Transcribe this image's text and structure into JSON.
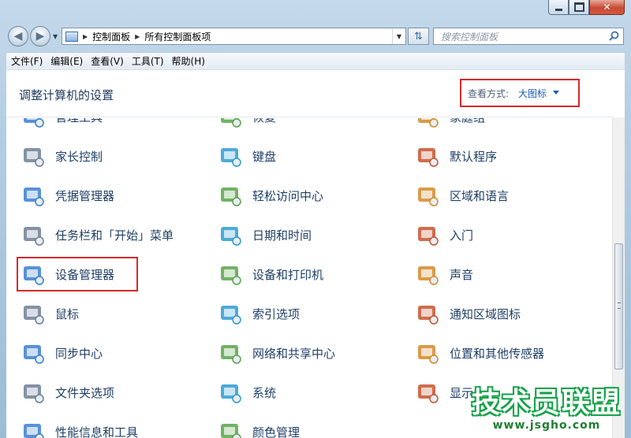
{
  "window": {
    "address_crumbs": [
      "控制面板",
      "所有控制面板项"
    ],
    "search_placeholder": "搜索控制面板"
  },
  "menu": [
    "文件(F)",
    "编辑(E)",
    "查看(V)",
    "工具(T)",
    "帮助(H)"
  ],
  "header": {
    "title": "调整计算机的设置",
    "view_label": "查看方式:",
    "view_value": "大图标"
  },
  "items": [
    {
      "label": "管理工具",
      "icon": "admin-tools-icon"
    },
    {
      "label": "恢复",
      "icon": "recovery-icon"
    },
    {
      "label": "家庭组",
      "icon": "homegroup-icon"
    },
    {
      "label": "家长控制",
      "icon": "parental-controls-icon"
    },
    {
      "label": "键盘",
      "icon": "keyboard-icon"
    },
    {
      "label": "默认程序",
      "icon": "default-programs-icon"
    },
    {
      "label": "凭据管理器",
      "icon": "credential-manager-icon"
    },
    {
      "label": "轻松访问中心",
      "icon": "ease-of-access-icon"
    },
    {
      "label": "区域和语言",
      "icon": "region-language-icon"
    },
    {
      "label": "任务栏和「开始」菜单",
      "icon": "taskbar-icon"
    },
    {
      "label": "日期和时间",
      "icon": "date-time-icon"
    },
    {
      "label": "入门",
      "icon": "getting-started-icon"
    },
    {
      "label": "设备管理器",
      "icon": "device-manager-icon"
    },
    {
      "label": "设备和打印机",
      "icon": "devices-printers-icon"
    },
    {
      "label": "声音",
      "icon": "sound-icon"
    },
    {
      "label": "鼠标",
      "icon": "mouse-icon"
    },
    {
      "label": "索引选项",
      "icon": "indexing-icon"
    },
    {
      "label": "通知区域图标",
      "icon": "notification-area-icon"
    },
    {
      "label": "同步中心",
      "icon": "sync-center-icon"
    },
    {
      "label": "网络和共享中心",
      "icon": "network-icon"
    },
    {
      "label": "位置和其他传感器",
      "icon": "location-sensors-icon"
    },
    {
      "label": "文件夹选项",
      "icon": "folder-options-icon"
    },
    {
      "label": "系统",
      "icon": "system-icon"
    },
    {
      "label": "显示",
      "icon": "display-icon"
    },
    {
      "label": "性能信息和工具",
      "icon": "performance-icon"
    },
    {
      "label": "颜色管理",
      "icon": "color-management-icon"
    }
  ],
  "watermark": {
    "title": "技术员联盟",
    "url": "www.jsgho.com"
  },
  "colors": {
    "highlight": "#d52a2a",
    "link": "#1a5bb5",
    "watermark_green": "#16a34a"
  }
}
